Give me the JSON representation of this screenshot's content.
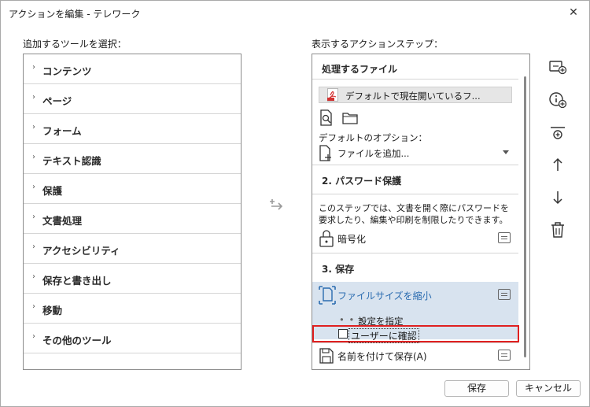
{
  "window": {
    "title": "アクションを編集 - テレワーク",
    "close_glyph": "✕"
  },
  "left": {
    "label": "追加するツールを選択：",
    "items": [
      {
        "label": "コンテンツ"
      },
      {
        "label": "ページ"
      },
      {
        "label": "フォーム"
      },
      {
        "label": "テキスト認識"
      },
      {
        "label": "保護"
      },
      {
        "label": "文書処理"
      },
      {
        "label": "アクセシビリティ"
      },
      {
        "label": "保存と書き出し"
      },
      {
        "label": "移動"
      },
      {
        "label": "その他のツール"
      }
    ]
  },
  "right": {
    "label": "表示するアクションステップ：",
    "sections": {
      "files_title": "処理するファイル",
      "file_value": "デフォルトで現在開いているフ...",
      "default_options_label": "デフォルトのオプション：",
      "add_file_option": "ファイルを追加...",
      "password_title": "2. パスワード保護",
      "password_desc": "このステップでは、文書を開く際にパスワードを要求したり、編集や印刷を制限したりできます。",
      "encrypt_label": "暗号化",
      "save_title": "3. 保存",
      "reduce_label": "ファイルサイズを縮小",
      "settings_label": "設定を指定",
      "settings_dots": "• • •",
      "confirm_label": "ユーザーに確認",
      "save_as_label": "名前を付けて保存(A)"
    }
  },
  "footer": {
    "save_label": "保存",
    "cancel_label": "キャンセル"
  },
  "colors": {
    "accent": "#2b6cb0",
    "selected_bg": "#d8e3ef",
    "highlight": "#e02020"
  }
}
